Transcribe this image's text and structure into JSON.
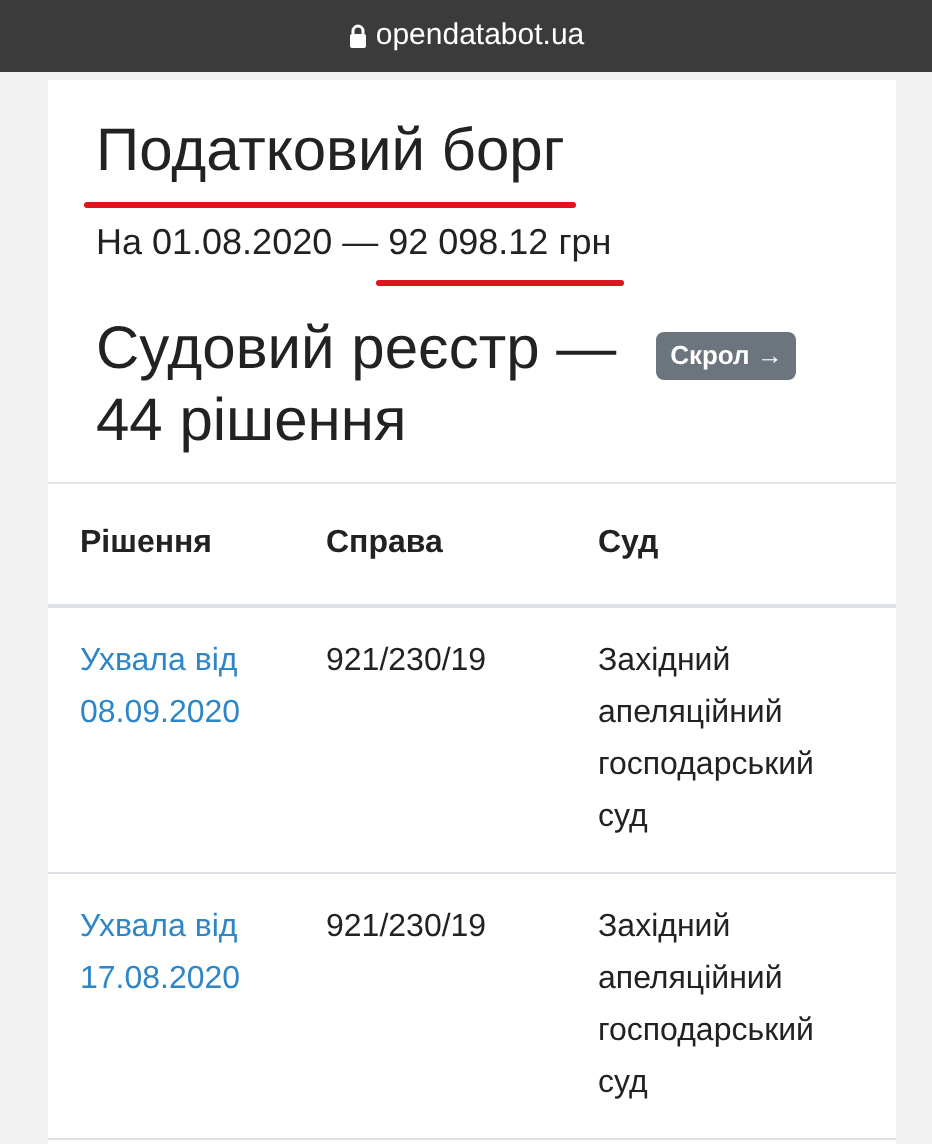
{
  "address_bar": {
    "url": "opendatabot.ua"
  },
  "tax_debt": {
    "title": "Податковий борг",
    "title_underlined": true,
    "date_text": "На 01.08.2020 —",
    "amount": "92 098.12 грн",
    "amount_underlined": true
  },
  "court_registry": {
    "heading": "Судовий реєстр —",
    "count": "44 рішення",
    "scroll_badge": "Скрол →"
  },
  "table": {
    "columns": [
      "Рішення",
      "Справа",
      "Суд"
    ],
    "rows": [
      {
        "decision": "Ухвала від 08.09.2020",
        "case": "921/230/19",
        "court": "Західний апеляційний господарський суд"
      },
      {
        "decision": "Ухвала від 17.08.2020",
        "case": "921/230/19",
        "court": "Західний апеляційний господарський суд"
      }
    ]
  }
}
